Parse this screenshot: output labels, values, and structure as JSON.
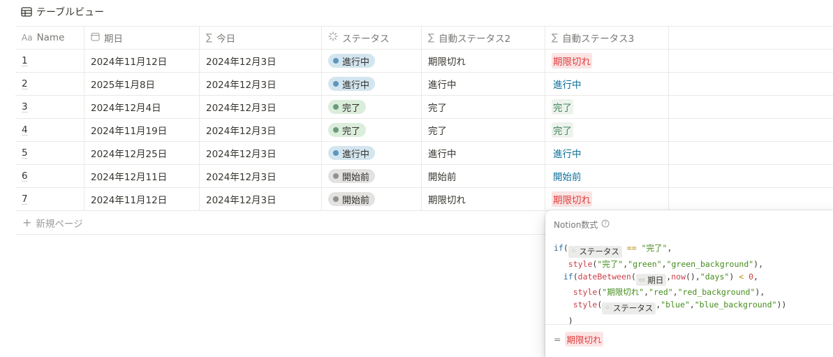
{
  "view": {
    "title": "テーブルビュー",
    "icon": "table-icon"
  },
  "columns": [
    {
      "label": "Name",
      "icon": "text-aa-icon"
    },
    {
      "label": "期日",
      "icon": "calendar-icon"
    },
    {
      "label": "今日",
      "icon": "sigma-icon"
    },
    {
      "label": "ステータス",
      "icon": "status-spinner-icon"
    },
    {
      "label": "自動ステータス2",
      "icon": "sigma-icon"
    },
    {
      "label": "自動ステータス3",
      "icon": "sigma-icon"
    }
  ],
  "rows": [
    {
      "name": "1",
      "due": "2024年11月12日",
      "today": "2024年12月3日",
      "status": "進行中",
      "status_color": "blue",
      "auto2": "期限切れ",
      "auto3": "期限切れ",
      "auto3_color": "red"
    },
    {
      "name": "2",
      "due": "2025年1月8日",
      "today": "2024年12月3日",
      "status": "進行中",
      "status_color": "blue",
      "auto2": "進行中",
      "auto3": "進行中",
      "auto3_color": "blue"
    },
    {
      "name": "3",
      "due": "2024年12月4日",
      "today": "2024年12月3日",
      "status": "完了",
      "status_color": "green",
      "auto2": "完了",
      "auto3": "完了",
      "auto3_color": "green"
    },
    {
      "name": "4",
      "due": "2024年11月19日",
      "today": "2024年12月3日",
      "status": "完了",
      "status_color": "green",
      "auto2": "完了",
      "auto3": "完了",
      "auto3_color": "green"
    },
    {
      "name": "5",
      "due": "2024年12月25日",
      "today": "2024年12月3日",
      "status": "進行中",
      "status_color": "blue",
      "auto2": "進行中",
      "auto3": "進行中",
      "auto3_color": "blue"
    },
    {
      "name": "6",
      "due": "2024年12月11日",
      "today": "2024年12月3日",
      "status": "開始前",
      "status_color": "gray",
      "auto2": "開始前",
      "auto3": "開始前",
      "auto3_color": "blue"
    },
    {
      "name": "7",
      "due": "2024年11月12日",
      "today": "2024年12月3日",
      "status": "開始前",
      "status_color": "gray",
      "auto2": "期限切れ",
      "auto3": "期限切れ",
      "auto3_color": "red"
    }
  ],
  "new_page": {
    "label": "新規ページ"
  },
  "formula": {
    "title": "Notion数式",
    "help_icon": "question-circle-icon",
    "code": {
      "if": "if",
      "status_prop": "ステータス",
      "eq": "==",
      "done": "\"完了\"",
      "style": "style",
      "green": "\"green\"",
      "green_bg": "\"green_background\"",
      "dateBetween": "dateBetween",
      "due_prop": "期日",
      "now": "now",
      "days": "\"days\"",
      "lt": "<",
      "zero": "0",
      "expired": "\"期限切れ\"",
      "red": "\"red\"",
      "red_bg": "\"red_background\"",
      "blue": "\"blue\"",
      "blue_bg": "\"blue_background\""
    },
    "result_prefix": "=",
    "result_value": "期限切れ"
  },
  "colors": {
    "red_text": "#e03e3e",
    "red_bg": "#fbe4e4",
    "green_text": "#448361",
    "green_bg": "#edf3ec",
    "blue_text": "#0b6e99",
    "pill_blue": "#d3e5ef",
    "pill_green": "#dbeddb",
    "pill_gray": "#e3e2e0"
  }
}
